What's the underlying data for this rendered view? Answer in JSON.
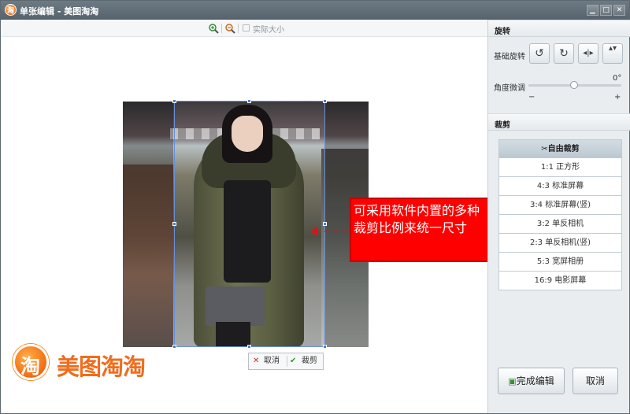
{
  "window": {
    "title": "单张编辑 - 美图淘淘",
    "app_icon_glyph": "淘",
    "minimize": "▁",
    "restore": "□",
    "close": "✕"
  },
  "toolbar": {
    "zoom_in_icon": "zoom-in-icon",
    "zoom_out_icon": "zoom-out-icon",
    "actual_size_label": "实际大小"
  },
  "crop_actions": {
    "cancel_label": "取消",
    "confirm_label": "裁剪"
  },
  "annotation": {
    "text": "可采用软件内置的多种裁剪比例来统一尺寸"
  },
  "logo": {
    "glyph": "淘",
    "text": "美图淘淘"
  },
  "panel": {
    "rotate_section": "旋转",
    "basic_rotate_label": "基础旋转",
    "rotate_buttons": [
      "↺",
      "↻",
      "◂|▸",
      "▴▾"
    ],
    "fine_tune_label": "角度微调",
    "angle_value": "0°",
    "minus": "−",
    "plus": "+",
    "crop_section": "裁剪",
    "crop_options": [
      "✂自由裁剪",
      "1:1 正方形",
      "4:3 标准屏幕",
      "3:4 标准屏幕(竖)",
      "3:2 单反相机",
      "2:3 单反相机(竖)",
      "5:3 宽屏相册",
      "16:9 电影屏幕"
    ],
    "finish_label": "完成编辑",
    "cancel_label": "取消"
  }
}
